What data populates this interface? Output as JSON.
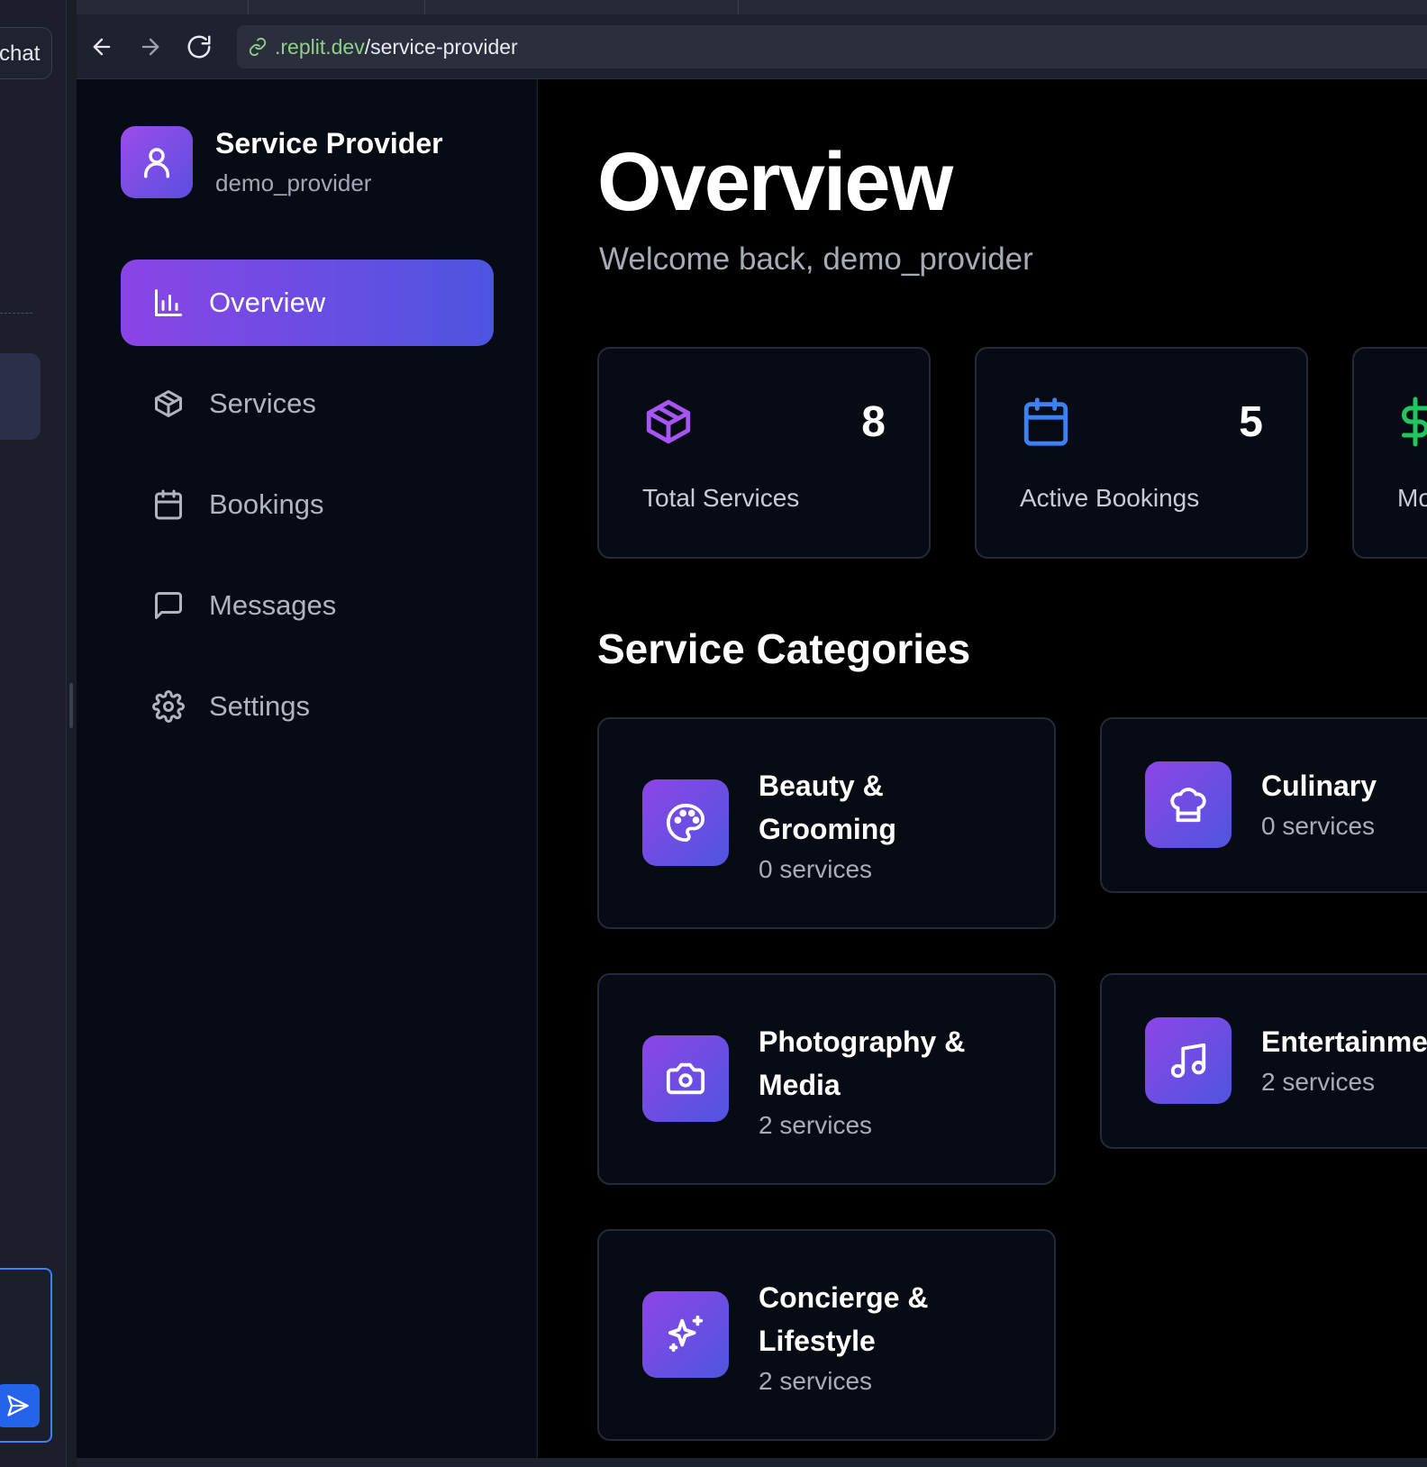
{
  "replit_panel": {
    "chat_label": "chat"
  },
  "browser": {
    "url_domain": ".replit.dev",
    "url_path": "/service-provider"
  },
  "sidebar": {
    "brand_title": "Service Provider",
    "brand_username": "demo_provider",
    "items": [
      {
        "label": "Overview",
        "icon": "bar-chart-icon",
        "active": true
      },
      {
        "label": "Services",
        "icon": "package-icon",
        "active": false
      },
      {
        "label": "Bookings",
        "icon": "calendar-icon",
        "active": false
      },
      {
        "label": "Messages",
        "icon": "message-square-icon",
        "active": false
      },
      {
        "label": "Settings",
        "icon": "gear-icon",
        "active": false
      }
    ]
  },
  "main": {
    "title": "Overview",
    "subtitle": "Welcome back, demo_provider",
    "stats": [
      {
        "label": "Total Services",
        "value": "8",
        "icon": "package-icon",
        "color": "#a855f7"
      },
      {
        "label": "Active Bookings",
        "value": "5",
        "icon": "calendar-icon",
        "color": "#3b82f6"
      },
      {
        "label": "Mo",
        "value": "",
        "icon": "dollar-icon",
        "color": "#22c55e"
      }
    ],
    "categories_title": "Service Categories",
    "categories": [
      {
        "name_line1": "Beauty &",
        "name_line2": "Grooming",
        "count": "0 services",
        "icon": "palette-icon"
      },
      {
        "name_line1": "Culinary",
        "name_line2": "",
        "count": "0 services",
        "icon": "chef-hat-icon"
      },
      {
        "name_line1": "Photography &",
        "name_line2": "Media",
        "count": "2 services",
        "icon": "camera-icon"
      },
      {
        "name_line1": "Entertainme",
        "name_line2": "",
        "count": "2 services",
        "icon": "music-icon"
      },
      {
        "name_line1": "Concierge &",
        "name_line2": "Lifestyle",
        "count": "2 services",
        "icon": "sparkles-icon"
      }
    ]
  },
  "colors": {
    "accent_start": "#8b44e6",
    "accent_end": "#4d55e0",
    "link_green": "#8fd18a"
  }
}
